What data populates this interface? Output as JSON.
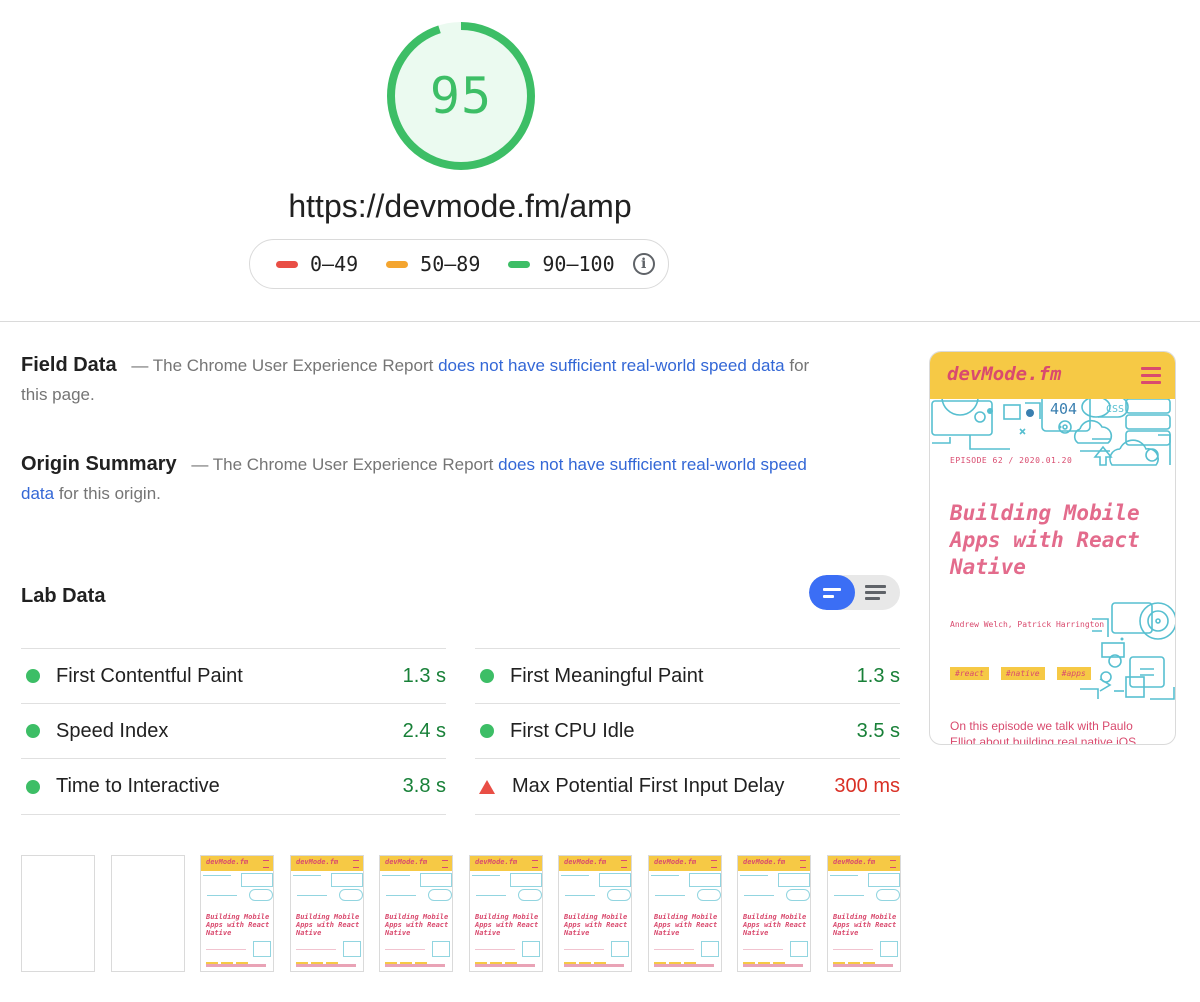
{
  "score": {
    "value": "95",
    "fraction": 0.95,
    "color": "#3dbe66"
  },
  "url": "https://devmode.fm/amp",
  "legend": [
    {
      "label": "0–49",
      "color": "#e94e45"
    },
    {
      "label": "50–89",
      "color": "#f4a52f"
    },
    {
      "label": "90–100",
      "color": "#3dbe66"
    }
  ],
  "legend_info_icon": "info-icon",
  "field_data": {
    "title": "Field Data",
    "dash": "—",
    "prefix": "The Chrome User Experience Report",
    "link": "does not have sufficient real-world speed data",
    "suffix": "for this page."
  },
  "origin_summary": {
    "title": "Origin Summary",
    "dash": "—",
    "prefix": "The Chrome User Experience Report",
    "link": "does not have sufficient real-world speed data",
    "suffix": "for this origin."
  },
  "lab_data": {
    "title": "Lab Data",
    "metrics": [
      {
        "name": "First Contentful Paint",
        "value": "1.3 s",
        "status": "pass"
      },
      {
        "name": "First Meaningful Paint",
        "value": "1.3 s",
        "status": "pass"
      },
      {
        "name": "Speed Index",
        "value": "2.4 s",
        "status": "pass"
      },
      {
        "name": "First CPU Idle",
        "value": "3.5 s",
        "status": "pass"
      },
      {
        "name": "Time to Interactive",
        "value": "3.8 s",
        "status": "pass"
      },
      {
        "name": "Max Potential First Input Delay",
        "value": "300 ms",
        "status": "fail"
      }
    ]
  },
  "preview": {
    "logo": "devMode.fm",
    "episode": "EPISODE 62 / 2020.01.20",
    "title": "Building Mobile Apps with React Native",
    "authors": "Andrew Welch, Patrick Harrington",
    "tags": [
      "#react",
      "#native",
      "#apps"
    ],
    "description": "On this episode we talk with Paulo Elliot about building real native iOS",
    "art_labels": {
      "error": "404",
      "css": "CSS"
    }
  },
  "filmstrip": {
    "blank_frames": 2,
    "loaded_frames": 8,
    "frame_logo": "devMode.fm",
    "frame_title": "Building Mobile Apps with React Native"
  },
  "colors": {
    "pass": "#3dbe66",
    "pass_text": "#188038",
    "fail": "#e94e45",
    "link": "#3367d6",
    "site_yellow": "#f6c945",
    "site_pink": "#d94a6e",
    "toggle_active": "#3b6ef5"
  }
}
